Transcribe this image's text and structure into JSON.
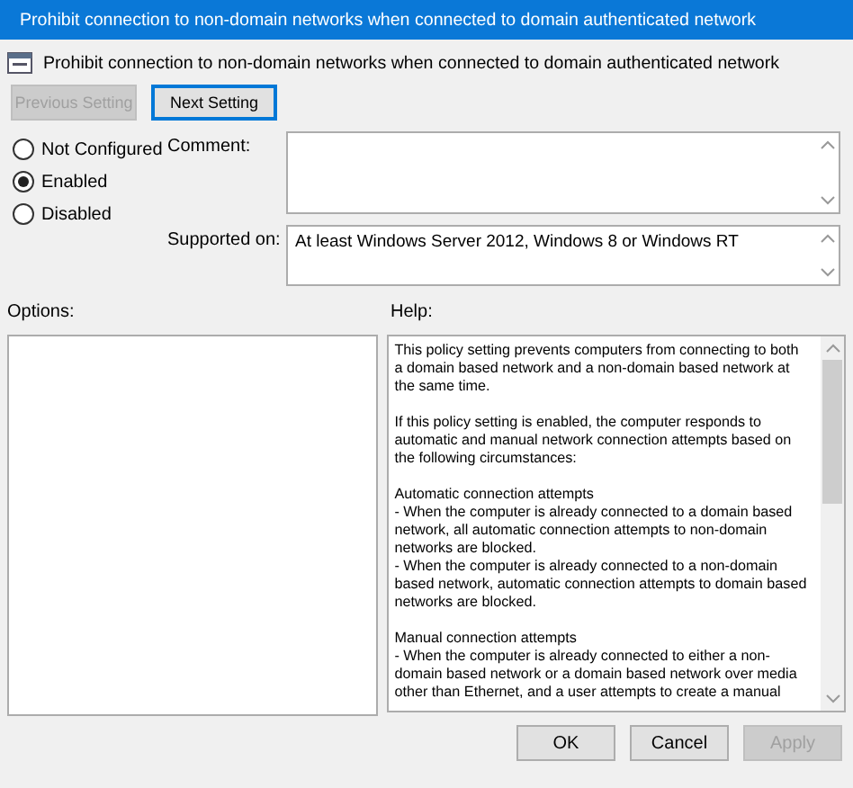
{
  "window": {
    "title": "Prohibit connection to non-domain networks when connected to domain authenticated network"
  },
  "policy_name": "Prohibit connection to non-domain networks when connected to domain authenticated network",
  "nav_buttons": [
    {
      "label": "Previous Setting",
      "disabled": true
    },
    {
      "label": "Next Setting",
      "disabled": false
    }
  ],
  "state_options": [
    {
      "label": "Not Configured",
      "selected": false
    },
    {
      "label": "Enabled",
      "selected": true
    },
    {
      "label": "Disabled",
      "selected": false
    }
  ],
  "comment": {
    "label": "Comment:"
  },
  "supported_on": {
    "label": "Supported on:",
    "value": "At least Windows Server 2012, Windows 8 or Windows RT"
  },
  "options": {
    "label": "Options:"
  },
  "help": {
    "label": "Help:",
    "paragraphs": [
      [
        "This policy setting prevents computers from connecting to both",
        "a domain based network and a non-domain based network at",
        "the same time."
      ],
      [
        "If this policy setting is enabled, the computer responds to",
        "automatic and manual network connection attempts based on",
        "the following circumstances:"
      ],
      [
        "Automatic connection attempts",
        "- When the computer is already connected to a domain based",
        "network, all automatic connection attempts to non-domain",
        "networks are blocked.",
        "- When the computer is already connected to a non-domain",
        "based network, automatic connection attempts to domain based",
        "networks are blocked."
      ],
      [
        "Manual connection attempts",
        "- When the computer is already connected to either a non-",
        "domain based network or a domain based network over media",
        "other than Ethernet, and a user attempts to create a manual"
      ]
    ]
  },
  "dialog_buttons": [
    {
      "label": "OK",
      "disabled": false
    },
    {
      "label": "Cancel",
      "disabled": false
    },
    {
      "label": "Apply",
      "disabled": true
    }
  ]
}
